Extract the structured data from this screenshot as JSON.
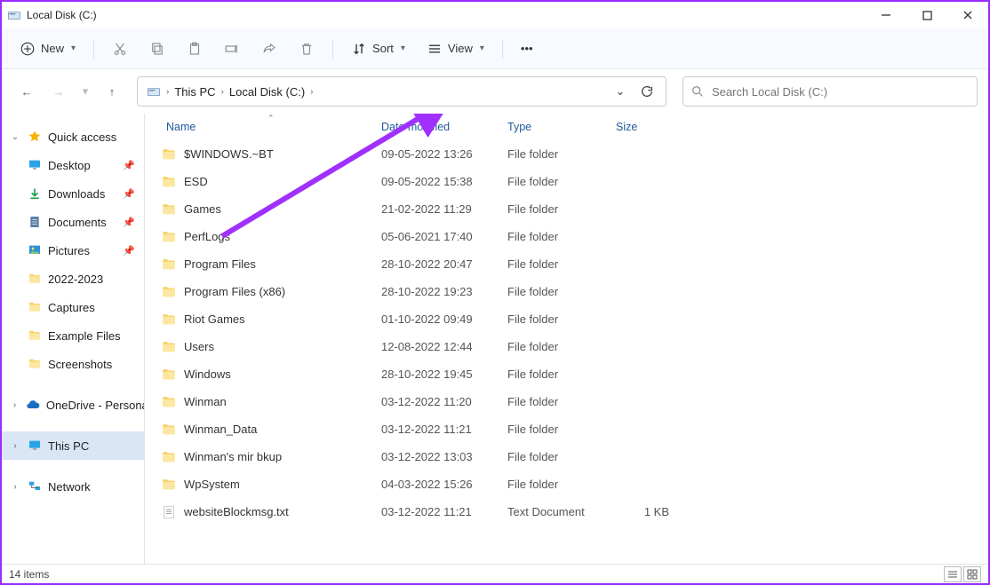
{
  "window": {
    "title": "Local Disk (C:)"
  },
  "toolbar": {
    "new_label": "New",
    "sort_label": "Sort",
    "view_label": "View"
  },
  "breadcrumbs": {
    "items": [
      {
        "label": "This PC"
      },
      {
        "label": "Local Disk (C:)"
      }
    ]
  },
  "search": {
    "placeholder": "Search Local Disk (C:)"
  },
  "sidebar": {
    "quick_access": "Quick access",
    "items": [
      {
        "label": "Desktop",
        "icon": "desktop",
        "pinned": true
      },
      {
        "label": "Downloads",
        "icon": "download",
        "pinned": true
      },
      {
        "label": "Documents",
        "icon": "document",
        "pinned": true
      },
      {
        "label": "Pictures",
        "icon": "pictures",
        "pinned": true
      },
      {
        "label": "2022-2023",
        "icon": "folder",
        "pinned": false
      },
      {
        "label": "Captures",
        "icon": "folder",
        "pinned": false
      },
      {
        "label": "Example Files",
        "icon": "folder",
        "pinned": false
      },
      {
        "label": "Screenshots",
        "icon": "folder",
        "pinned": false
      }
    ],
    "onedrive": "OneDrive - Personal",
    "this_pc": "This PC",
    "network": "Network"
  },
  "columns": {
    "name": "Name",
    "date": "Date modified",
    "type": "Type",
    "size": "Size"
  },
  "files": [
    {
      "name": "$WINDOWS.~BT",
      "date": "09-05-2022 13:26",
      "type": "File folder",
      "size": "",
      "icon": "folder"
    },
    {
      "name": "ESD",
      "date": "09-05-2022 15:38",
      "type": "File folder",
      "size": "",
      "icon": "folder"
    },
    {
      "name": "Games",
      "date": "21-02-2022 11:29",
      "type": "File folder",
      "size": "",
      "icon": "folder"
    },
    {
      "name": "PerfLogs",
      "date": "05-06-2021 17:40",
      "type": "File folder",
      "size": "",
      "icon": "folder"
    },
    {
      "name": "Program Files",
      "date": "28-10-2022 20:47",
      "type": "File folder",
      "size": "",
      "icon": "folder"
    },
    {
      "name": "Program Files (x86)",
      "date": "28-10-2022 19:23",
      "type": "File folder",
      "size": "",
      "icon": "folder"
    },
    {
      "name": "Riot Games",
      "date": "01-10-2022 09:49",
      "type": "File folder",
      "size": "",
      "icon": "folder"
    },
    {
      "name": "Users",
      "date": "12-08-2022 12:44",
      "type": "File folder",
      "size": "",
      "icon": "folder"
    },
    {
      "name": "Windows",
      "date": "28-10-2022 19:45",
      "type": "File folder",
      "size": "",
      "icon": "folder"
    },
    {
      "name": "Winman",
      "date": "03-12-2022 11:20",
      "type": "File folder",
      "size": "",
      "icon": "folder"
    },
    {
      "name": "Winman_Data",
      "date": "03-12-2022 11:21",
      "type": "File folder",
      "size": "",
      "icon": "folder"
    },
    {
      "name": "Winman's mir bkup",
      "date": "03-12-2022 13:03",
      "type": "File folder",
      "size": "",
      "icon": "folder"
    },
    {
      "name": "WpSystem",
      "date": "04-03-2022 15:26",
      "type": "File folder",
      "size": "",
      "icon": "folder"
    },
    {
      "name": "websiteBlockmsg.txt",
      "date": "03-12-2022 11:21",
      "type": "Text Document",
      "size": "1 KB",
      "icon": "text"
    }
  ],
  "status": {
    "item_count": "14 items"
  }
}
